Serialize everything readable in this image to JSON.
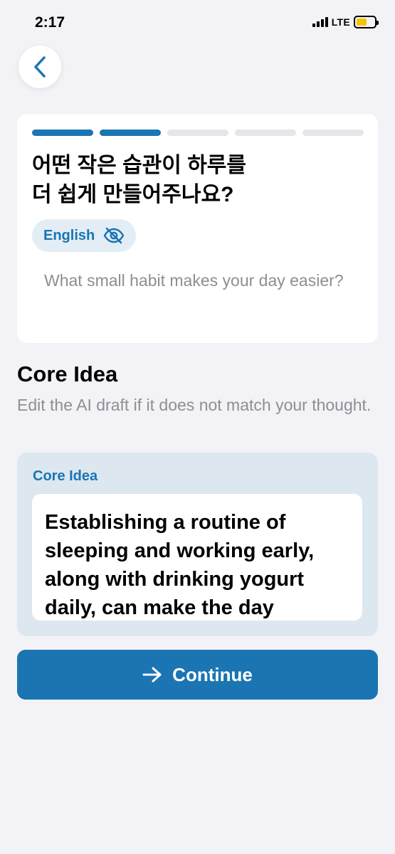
{
  "status_bar": {
    "time": "2:17",
    "network": "LTE"
  },
  "header": {
    "back_icon": "chevron-left-icon"
  },
  "progress": {
    "total_steps": 5,
    "completed_steps": 2
  },
  "question": {
    "title_line1": "어떤 작은 습관이 하루를",
    "title_line2": "더 쉽게 만들어주나요?",
    "language_toggle_label": "English",
    "language_toggle_icon": "eye-slash-icon",
    "translation": "What small habit makes your day easier?"
  },
  "section": {
    "title": "Core Idea",
    "subtitle": "Edit the AI draft if it does not match your thought."
  },
  "core_idea": {
    "label": "Core Idea",
    "text": "Establishing a routine of sleeping and working early, along with drinking yogurt daily, can make the day"
  },
  "continue_button": {
    "label": "Continue",
    "icon": "arrow-right-icon"
  },
  "colors": {
    "accent": "#1a75b2",
    "background": "#f2f2f7",
    "panel": "#dde7f0",
    "toggle_bg": "#e3edf6",
    "battery": "#f5c400"
  }
}
